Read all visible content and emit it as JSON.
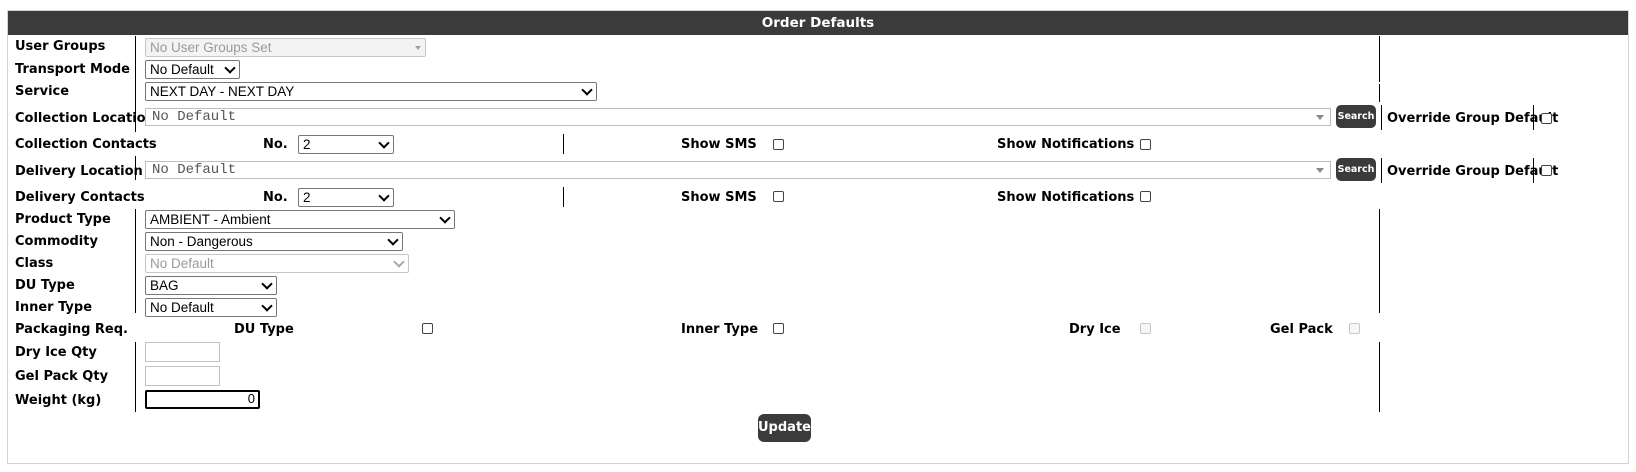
{
  "title": "Order Defaults",
  "labels": {
    "user_groups": "User Groups",
    "transport_mode": "Transport Mode",
    "service": "Service",
    "collection_location": "Collection Location",
    "collection_contacts": "Collection Contacts",
    "delivery_location": "Delivery Location",
    "delivery_contacts": "Delivery Contacts",
    "product_type": "Product Type",
    "commodity": "Commodity",
    "class": "Class",
    "du_type": "DU Type",
    "inner_type": "Inner Type",
    "packaging_req": "Packaging Req.",
    "dry_ice_qty": "Dry Ice Qty",
    "gel_pack_qty": "Gel Pack Qty",
    "weight": "Weight (kg)"
  },
  "selects": {
    "user_groups": "No User Groups Set",
    "transport_mode": "No Default",
    "service": "NEXT DAY - NEXT DAY",
    "product_type": "AMBIENT - Ambient",
    "commodity": "Non - Dangerous",
    "class": "No Default",
    "du_type": "BAG",
    "inner_type": "No Default"
  },
  "collection": {
    "location_value": "No Default",
    "search_label": "Search",
    "override_label": "Override Group Default",
    "override_checked": false,
    "no_label": "No.",
    "no_value": "2",
    "show_sms_label": "Show SMS",
    "show_sms_checked": false,
    "show_notifications_label": "Show Notifications",
    "show_notifications_checked": false
  },
  "delivery": {
    "location_value": "No Default",
    "search_label": "Search",
    "override_label": "Override Group Default",
    "override_checked": false,
    "no_label": "No.",
    "no_value": "2",
    "show_sms_label": "Show SMS",
    "show_sms_checked": false,
    "show_notifications_label": "Show Notifications",
    "show_notifications_checked": false
  },
  "packaging": {
    "du_type_label": "DU Type",
    "inner_type_label": "Inner Type",
    "dry_ice_label": "Dry Ice",
    "gel_pack_label": "Gel Pack"
  },
  "inputs": {
    "dry_ice_qty": "",
    "gel_pack_qty": "",
    "weight": "0"
  },
  "update_label": "Update",
  "colors": {
    "header_bg": "#3b3b3b",
    "button_bg": "#3b3b3b"
  }
}
